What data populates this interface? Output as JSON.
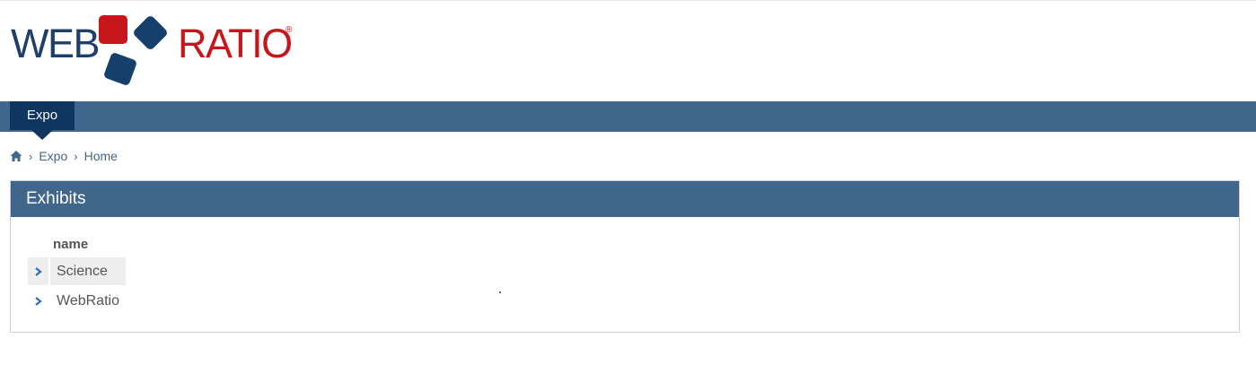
{
  "logo": {
    "word_left": "WEB",
    "word_right": "RATIO",
    "registered": "®"
  },
  "nav": {
    "active_tab": "Expo"
  },
  "breadcrumb": {
    "home_icon": "home-icon",
    "separator": "›",
    "items": [
      "Expo",
      "Home"
    ]
  },
  "panel": {
    "title": "Exhibits",
    "column_header": "name",
    "rows": [
      {
        "label": "Science",
        "selected": true
      },
      {
        "label": "WebRatio",
        "selected": false
      }
    ],
    "row_icon": "chevron-right-icon"
  },
  "colors": {
    "nav_bar": "#41668b",
    "nav_tab_active": "#0f3560",
    "logo_blue": "#1d3f68",
    "logo_red": "#c8161d",
    "text": "#555555",
    "row_selected_bg": "#eeeeee",
    "chevron": "#2f6fb7"
  }
}
